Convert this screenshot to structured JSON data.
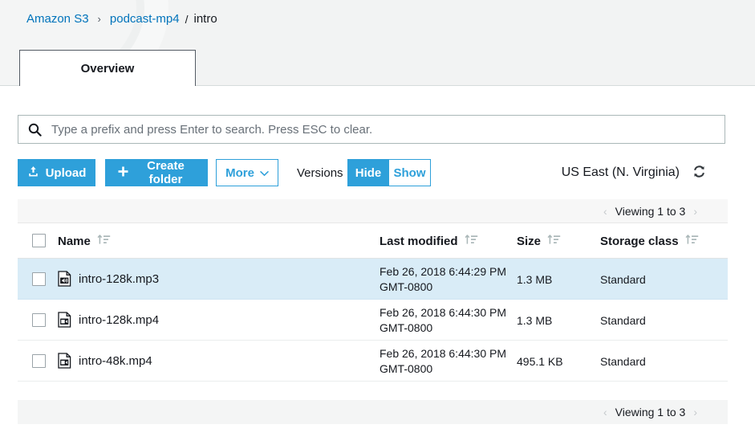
{
  "breadcrumb": {
    "root": "Amazon S3",
    "separator1": "›",
    "bucket": "podcast-mp4",
    "separator2": "/",
    "current": "intro"
  },
  "tabs": [
    {
      "label": "Overview",
      "active": true
    }
  ],
  "search": {
    "placeholder": "Type a prefix and press Enter to search. Press ESC to clear.",
    "value": "",
    "icon": "search-icon"
  },
  "toolbar": {
    "upload_label": "Upload",
    "upload_icon": "upload-icon",
    "create_folder_label": "Create folder",
    "create_folder_icon": "plus-icon",
    "more_label": "More",
    "more_icon": "chevron-down-icon",
    "versions_label": "Versions",
    "versions_hide_label": "Hide",
    "versions_show_label": "Show",
    "versions_selected": "Hide",
    "region_label": "US East (N. Virginia)",
    "refresh_icon": "refresh-icon"
  },
  "table": {
    "pagination_top": "Viewing 1 to 3",
    "pagination_bottom": "Viewing 1 to 3",
    "prev_icon": "chevron-left-icon",
    "next_icon": "chevron-right-icon",
    "columns": [
      {
        "label": "Name",
        "sort_icon": "sort-ascending-icon"
      },
      {
        "label": "Last modified",
        "sort_icon": "sort-ascending-icon"
      },
      {
        "label": "Size",
        "sort_icon": "sort-ascending-icon"
      },
      {
        "label": "Storage class",
        "sort_icon": "sort-ascending-icon"
      }
    ],
    "rows": [
      {
        "name": "intro-128k.mp3",
        "icon": "audio-file-icon",
        "modified_line1": "Feb 26, 2018 6:44:29 PM",
        "modified_line2": "GMT-0800",
        "size": "1.3 MB",
        "storage_class": "Standard",
        "selected": true,
        "checked": false
      },
      {
        "name": "intro-128k.mp4",
        "icon": "video-file-icon",
        "modified_line1": "Feb 26, 2018 6:44:30 PM",
        "modified_line2": "GMT-0800",
        "size": "1.3 MB",
        "storage_class": "Standard",
        "selected": false,
        "checked": false
      },
      {
        "name": "intro-48k.mp4",
        "icon": "video-file-icon",
        "modified_line1": "Feb 26, 2018 6:44:30 PM",
        "modified_line2": "GMT-0800",
        "size": "495.1 KB",
        "storage_class": "Standard",
        "selected": false,
        "checked": false
      }
    ]
  },
  "colors": {
    "accent_blue": "#2ea0da",
    "link_blue": "#0073bb",
    "selected_row": "#d9ecf7",
    "header_bg": "#f2f3f3",
    "text_dark": "#16191f"
  }
}
